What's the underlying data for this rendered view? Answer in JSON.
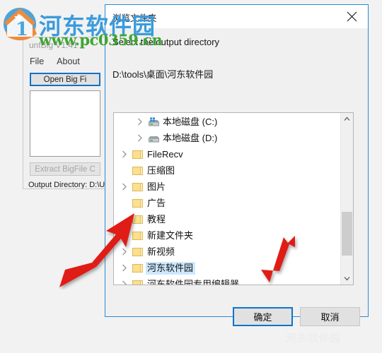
{
  "background_app": {
    "title": "unfBig V1.41",
    "menu": [
      "File",
      "About"
    ],
    "open_button": "Open Big Fi",
    "extract_button": "Extract BigFile C",
    "status": "Output Directory: D:\\Un"
  },
  "dialog": {
    "title": "浏览文件夹",
    "close_icon": "close-icon",
    "prompt": "Select the output directory",
    "current_path": "D:\\tools\\桌面\\河东软件园",
    "tree": [
      {
        "label": "本地磁盘 (C:)",
        "icon": "drive-system-icon",
        "indent": 1,
        "expandable": true,
        "selected": false
      },
      {
        "label": "本地磁盘 (D:)",
        "icon": "drive-icon",
        "indent": 1,
        "expandable": true,
        "selected": false
      },
      {
        "label": "FileRecv",
        "icon": "folder-icon",
        "indent": 0,
        "expandable": true,
        "selected": false
      },
      {
        "label": "压缩图",
        "icon": "folder-icon",
        "indent": 0,
        "expandable": false,
        "selected": false
      },
      {
        "label": "图片",
        "icon": "folder-icon",
        "indent": 0,
        "expandable": true,
        "selected": false
      },
      {
        "label": "广告",
        "icon": "folder-icon",
        "indent": 0,
        "expandable": false,
        "selected": false
      },
      {
        "label": "教程",
        "icon": "folder-icon",
        "indent": 0,
        "expandable": false,
        "selected": false
      },
      {
        "label": "新建文件夹",
        "icon": "folder-icon",
        "indent": 0,
        "expandable": true,
        "selected": false
      },
      {
        "label": "新视频",
        "icon": "folder-icon",
        "indent": 0,
        "expandable": true,
        "selected": false
      },
      {
        "label": "河东软件园",
        "icon": "folder-icon",
        "indent": 0,
        "expandable": true,
        "selected": true
      },
      {
        "label": "河东软件园专用编辑器",
        "icon": "folder-icon",
        "indent": 0,
        "expandable": true,
        "selected": false
      }
    ],
    "scrollbar": {
      "up_icon": "chevron-up-icon",
      "down_icon": "chevron-down-icon"
    },
    "ok_button": "确定",
    "cancel_button": "取消"
  },
  "watermark": {
    "site_name": "河东软件园",
    "url": "www.pc0359.cn",
    "bottom": "河东软件园"
  },
  "colors": {
    "focus_blue": "#1273c9",
    "dialog_border": "#2a8ad4",
    "selection": "#cde8ff",
    "folder": "#fcdf8f",
    "arrow_red": "#e01b12",
    "watermark_blue": "#3a9bdc",
    "watermark_green": "#3fa535"
  }
}
